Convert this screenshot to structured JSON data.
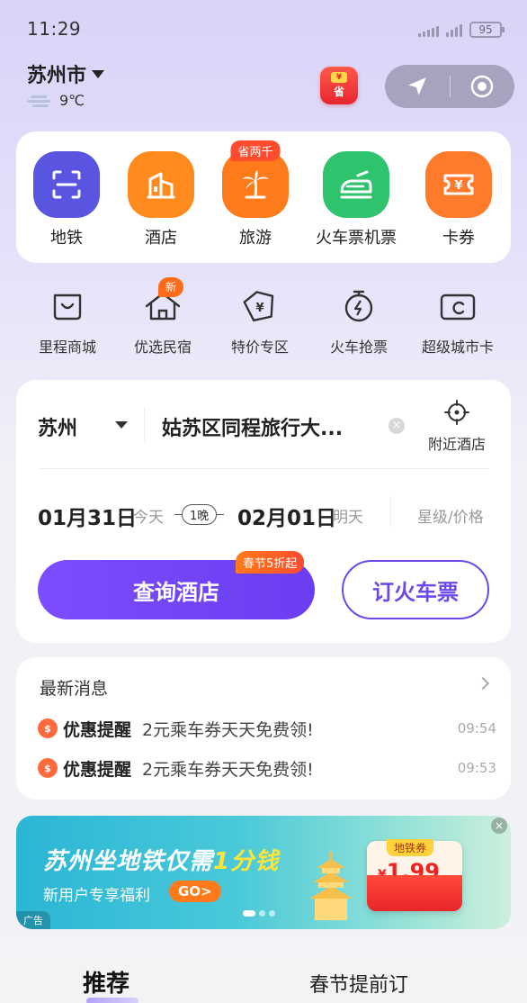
{
  "status_bar": {
    "time": "11:29",
    "battery": "95"
  },
  "header": {
    "city": "苏州市",
    "temperature": "9℃",
    "coupon_badge": {
      "top": "¥",
      "bottom": "省"
    }
  },
  "main_nav": [
    {
      "label": "地铁",
      "color": "#5a55e0",
      "tag": ""
    },
    {
      "label": "酒店",
      "color": "#ff8a1e",
      "tag": ""
    },
    {
      "label": "旅游",
      "color": "#ff7a1a",
      "tag": "省两千"
    },
    {
      "label": "火车票机票",
      "color": "#2fc36e",
      "tag": ""
    },
    {
      "label": "卡券",
      "color": "#ff7a2a",
      "tag": ""
    }
  ],
  "sub_nav": [
    {
      "label": "里程商城",
      "tag": ""
    },
    {
      "label": "优选民宿",
      "tag": "新"
    },
    {
      "label": "特价专区",
      "tag": ""
    },
    {
      "label": "火车抢票",
      "tag": ""
    },
    {
      "label": "超级城市卡",
      "tag": ""
    }
  ],
  "hotel_search": {
    "city": "苏州",
    "destination": "姑苏区同程旅行大...",
    "nearby_label": "附近酒店",
    "checkin_date": "01月31日",
    "checkin_day": "今天",
    "nights": "1晚",
    "checkout_date": "02月01日",
    "checkout_day": "明天",
    "star_price": "星级/价格",
    "search_button": "查询酒店",
    "promo_tag": "春节5折起",
    "train_button": "订火车票"
  },
  "news": {
    "title": "最新消息",
    "items": [
      {
        "type": "优惠提醒",
        "text": "2元乘车券天天免费领!",
        "time": "09:54"
      },
      {
        "type": "优惠提醒",
        "text": "2元乘车券天天免费领!",
        "time": "09:53"
      }
    ]
  },
  "ad": {
    "title_part1": "苏州坐地铁仅需",
    "title_highlight": "1分钱",
    "subtitle": "新用户专享福利",
    "go_label": "GO>",
    "ticket_tag": "地铁券",
    "price_symbol": "¥",
    "price": "1.99",
    "ad_label": "广告",
    "close": "×"
  },
  "tabs": {
    "recommend": "推荐",
    "spring": "春节提前订"
  }
}
